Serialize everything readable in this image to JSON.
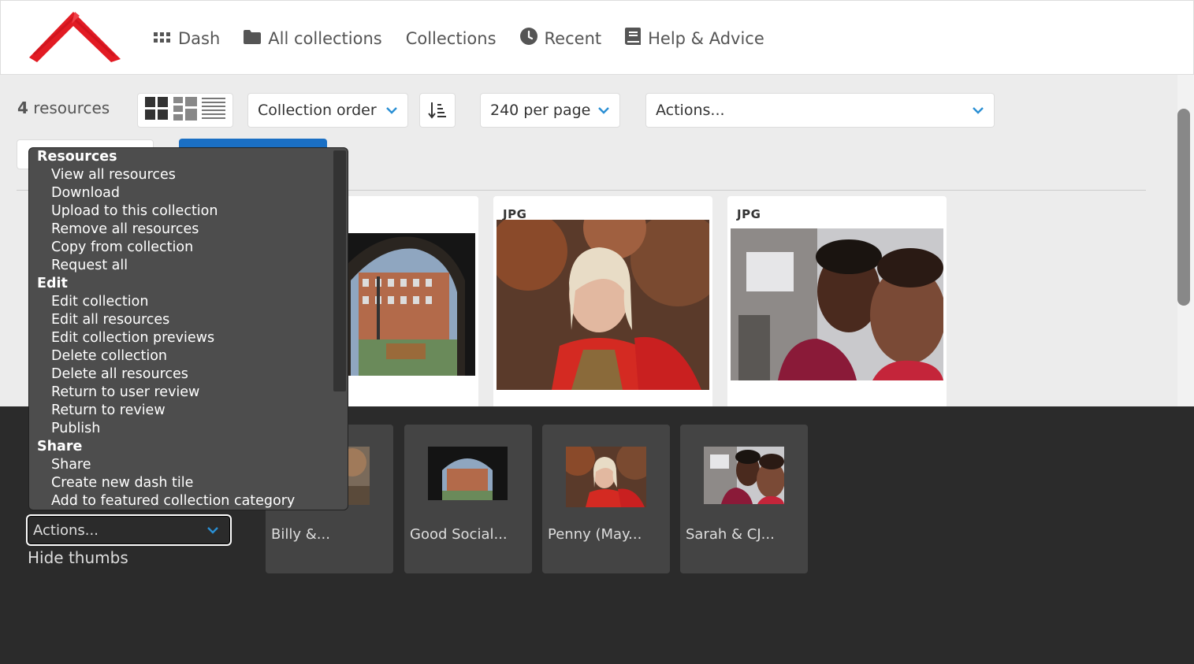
{
  "nav": {
    "items": [
      {
        "label": "Dash",
        "icon": "grid-icon"
      },
      {
        "label": "All collections",
        "icon": "folder-icon"
      },
      {
        "label": "Collections",
        "icon": ""
      },
      {
        "label": "Recent",
        "icon": "clock-icon"
      },
      {
        "label": "Help & Advice",
        "icon": "book-icon"
      }
    ]
  },
  "toolbar": {
    "resource_count": "4",
    "resource_count_suffix": "resources",
    "sort_select": "Collection order",
    "per_page_select": "240 per page",
    "actions_select": "Actions..."
  },
  "results": {
    "cards": [
      {
        "type": "JPG"
      },
      {
        "type": "JPG"
      }
    ]
  },
  "collection_bar": {
    "actions_select": "Actions...",
    "hide_thumbs": "Hide thumbs",
    "thumbs": [
      {
        "label": "Billy &..."
      },
      {
        "label": "Good Social..."
      },
      {
        "label": "Penny (May..."
      },
      {
        "label": "Sarah & CJ..."
      }
    ]
  },
  "actions_menu": {
    "groups": [
      {
        "label": "Resources",
        "items": [
          "View all resources",
          "Download",
          "Upload to this collection",
          "Remove all resources",
          "Copy from collection",
          "Request all"
        ]
      },
      {
        "label": "Edit",
        "items": [
          "Edit collection",
          "Edit all resources",
          "Edit collection previews",
          "Delete collection",
          "Delete all resources",
          "Return to user review",
          "Return to review",
          "Publish"
        ]
      },
      {
        "label": "Share",
        "items": [
          "Share",
          "Create new dash tile",
          "Add to featured collection category"
        ]
      }
    ]
  },
  "colors": {
    "brand_red": "#e21b23",
    "accent_blue": "#1a6fc4",
    "chevron_blue": "#2a8fd4",
    "collection_bar_bg": "#2b2b2b",
    "menu_bg": "#4d4d4d"
  }
}
